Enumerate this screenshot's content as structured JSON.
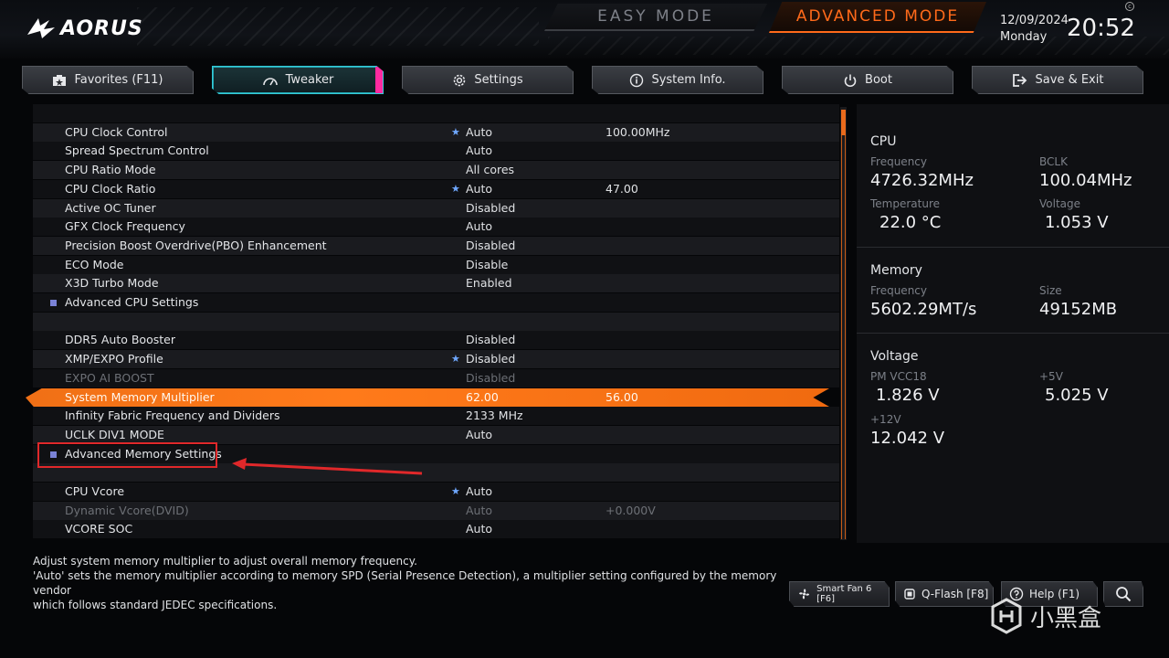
{
  "header": {
    "brand": "AORUS",
    "easy_mode": "EASY MODE",
    "advanced_mode": "ADVANCED MODE",
    "date": "12/09/2024",
    "weekday": "Monday",
    "time": "20:52"
  },
  "tabs": [
    {
      "label": "Favorites (F11)",
      "icon": "favorites-icon"
    },
    {
      "label": "Tweaker",
      "icon": "speedometer-icon"
    },
    {
      "label": "Settings",
      "icon": "gear-icon"
    },
    {
      "label": "System Info.",
      "icon": "info-icon"
    },
    {
      "label": "Boot",
      "icon": "power-icon"
    },
    {
      "label": "Save & Exit",
      "icon": "exit-icon"
    }
  ],
  "active_tab": "Tweaker",
  "settings": [
    {
      "label": "",
      "value": "",
      "value2": ""
    },
    {
      "label": "CPU Clock Control",
      "value": "Auto",
      "value2": "100.00MHz",
      "star": true
    },
    {
      "label": "Spread Spectrum Control",
      "value": "Auto",
      "value2": ""
    },
    {
      "label": "CPU Ratio Mode",
      "value": "All cores",
      "value2": ""
    },
    {
      "label": "CPU Clock Ratio",
      "value": "Auto",
      "value2": "47.00",
      "star": true
    },
    {
      "label": "Active OC Tuner",
      "value": "Disabled",
      "value2": ""
    },
    {
      "label": "GFX Clock Frequency",
      "value": "Auto",
      "value2": ""
    },
    {
      "label": "Precision Boost Overdrive(PBO) Enhancement",
      "value": "Disabled",
      "value2": ""
    },
    {
      "label": "ECO Mode",
      "value": "Disable",
      "value2": ""
    },
    {
      "label": "X3D Turbo Mode",
      "value": "Enabled",
      "value2": ""
    },
    {
      "label": "Advanced CPU Settings",
      "value": "",
      "value2": "",
      "submenu": true
    },
    {
      "label": "",
      "value": "",
      "value2": ""
    },
    {
      "label": "DDR5 Auto Booster",
      "value": "Disabled",
      "value2": ""
    },
    {
      "label": "XMP/EXPO Profile",
      "value": "Disabled",
      "value2": "",
      "star": true
    },
    {
      "label": "EXPO AI BOOST",
      "value": "Disabled",
      "value2": "",
      "dim": true
    },
    {
      "label": "System Memory Multiplier",
      "value": "62.00",
      "value2": "56.00",
      "selected": true
    },
    {
      "label": "Infinity Fabric Frequency and Dividers",
      "value": "2133 MHz",
      "value2": ""
    },
    {
      "label": "UCLK DIV1 MODE",
      "value": "Auto",
      "value2": ""
    },
    {
      "label": "Advanced Memory Settings",
      "value": "",
      "value2": "",
      "submenu": true
    },
    {
      "label": "",
      "value": "",
      "value2": ""
    },
    {
      "label": "CPU Vcore",
      "value": "Auto",
      "value2": "",
      "star": true
    },
    {
      "label": "Dynamic Vcore(DVID)",
      "value": "Auto",
      "value2": "+0.000V",
      "dim": true
    },
    {
      "label": "VCORE SOC",
      "value": "Auto",
      "value2": ""
    }
  ],
  "monitor": {
    "cpu": {
      "title": "CPU",
      "freq_label": "Frequency",
      "freq": "4726.32MHz",
      "bclk_label": "BCLK",
      "bclk": "100.04MHz",
      "temp_label": "Temperature",
      "temp": "22.0 °C",
      "volt_label": "Voltage",
      "volt": "1.053 V"
    },
    "memory": {
      "title": "Memory",
      "freq_label": "Frequency",
      "freq": "5602.29MT/s",
      "size_label": "Size",
      "size": "49152MB"
    },
    "voltage": {
      "title": "Voltage",
      "pm_label": "PM VCC18",
      "pm": "1.826 V",
      "v5_label": "+5V",
      "v5": "5.025 V",
      "v12_label": "+12V",
      "v12": "12.042 V"
    }
  },
  "help_text": [
    "Adjust system memory multiplier to adjust overall memory frequency.",
    "'Auto' sets the memory multiplier according to memory SPD (Serial Presence Detection), a multiplier setting configured by the memory vendor",
    "which follows standard JEDEC specifications."
  ],
  "bottom_buttons": {
    "smart_fan": "Smart Fan 6 [F6]",
    "qflash": "Q-Flash [F8]",
    "help": "Help (F1)"
  },
  "watermark": "小黑盒",
  "colors": {
    "accent_orange": "#ff6a1a",
    "active_tab_cyan": "#35c9d6",
    "annotation_red": "#e0282a"
  }
}
